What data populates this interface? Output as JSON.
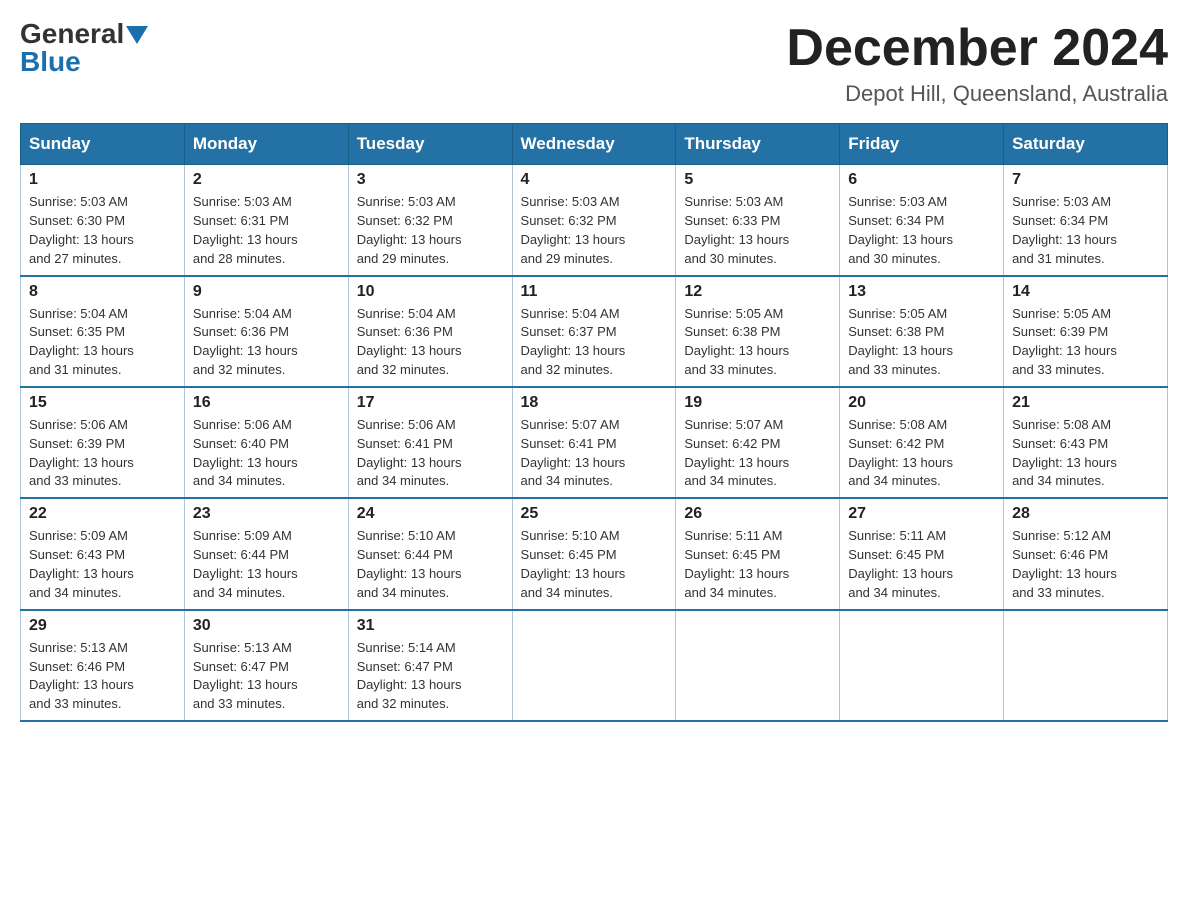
{
  "header": {
    "logo_general": "General",
    "logo_blue": "Blue",
    "title": "December 2024",
    "subtitle": "Depot Hill, Queensland, Australia"
  },
  "days_of_week": [
    "Sunday",
    "Monday",
    "Tuesday",
    "Wednesday",
    "Thursday",
    "Friday",
    "Saturday"
  ],
  "weeks": [
    [
      {
        "day": "1",
        "sunrise": "5:03 AM",
        "sunset": "6:30 PM",
        "daylight": "13 hours and 27 minutes."
      },
      {
        "day": "2",
        "sunrise": "5:03 AM",
        "sunset": "6:31 PM",
        "daylight": "13 hours and 28 minutes."
      },
      {
        "day": "3",
        "sunrise": "5:03 AM",
        "sunset": "6:32 PM",
        "daylight": "13 hours and 29 minutes."
      },
      {
        "day": "4",
        "sunrise": "5:03 AM",
        "sunset": "6:32 PM",
        "daylight": "13 hours and 29 minutes."
      },
      {
        "day": "5",
        "sunrise": "5:03 AM",
        "sunset": "6:33 PM",
        "daylight": "13 hours and 30 minutes."
      },
      {
        "day": "6",
        "sunrise": "5:03 AM",
        "sunset": "6:34 PM",
        "daylight": "13 hours and 30 minutes."
      },
      {
        "day": "7",
        "sunrise": "5:03 AM",
        "sunset": "6:34 PM",
        "daylight": "13 hours and 31 minutes."
      }
    ],
    [
      {
        "day": "8",
        "sunrise": "5:04 AM",
        "sunset": "6:35 PM",
        "daylight": "13 hours and 31 minutes."
      },
      {
        "day": "9",
        "sunrise": "5:04 AM",
        "sunset": "6:36 PM",
        "daylight": "13 hours and 32 minutes."
      },
      {
        "day": "10",
        "sunrise": "5:04 AM",
        "sunset": "6:36 PM",
        "daylight": "13 hours and 32 minutes."
      },
      {
        "day": "11",
        "sunrise": "5:04 AM",
        "sunset": "6:37 PM",
        "daylight": "13 hours and 32 minutes."
      },
      {
        "day": "12",
        "sunrise": "5:05 AM",
        "sunset": "6:38 PM",
        "daylight": "13 hours and 33 minutes."
      },
      {
        "day": "13",
        "sunrise": "5:05 AM",
        "sunset": "6:38 PM",
        "daylight": "13 hours and 33 minutes."
      },
      {
        "day": "14",
        "sunrise": "5:05 AM",
        "sunset": "6:39 PM",
        "daylight": "13 hours and 33 minutes."
      }
    ],
    [
      {
        "day": "15",
        "sunrise": "5:06 AM",
        "sunset": "6:39 PM",
        "daylight": "13 hours and 33 minutes."
      },
      {
        "day": "16",
        "sunrise": "5:06 AM",
        "sunset": "6:40 PM",
        "daylight": "13 hours and 34 minutes."
      },
      {
        "day": "17",
        "sunrise": "5:06 AM",
        "sunset": "6:41 PM",
        "daylight": "13 hours and 34 minutes."
      },
      {
        "day": "18",
        "sunrise": "5:07 AM",
        "sunset": "6:41 PM",
        "daylight": "13 hours and 34 minutes."
      },
      {
        "day": "19",
        "sunrise": "5:07 AM",
        "sunset": "6:42 PM",
        "daylight": "13 hours and 34 minutes."
      },
      {
        "day": "20",
        "sunrise": "5:08 AM",
        "sunset": "6:42 PM",
        "daylight": "13 hours and 34 minutes."
      },
      {
        "day": "21",
        "sunrise": "5:08 AM",
        "sunset": "6:43 PM",
        "daylight": "13 hours and 34 minutes."
      }
    ],
    [
      {
        "day": "22",
        "sunrise": "5:09 AM",
        "sunset": "6:43 PM",
        "daylight": "13 hours and 34 minutes."
      },
      {
        "day": "23",
        "sunrise": "5:09 AM",
        "sunset": "6:44 PM",
        "daylight": "13 hours and 34 minutes."
      },
      {
        "day": "24",
        "sunrise": "5:10 AM",
        "sunset": "6:44 PM",
        "daylight": "13 hours and 34 minutes."
      },
      {
        "day": "25",
        "sunrise": "5:10 AM",
        "sunset": "6:45 PM",
        "daylight": "13 hours and 34 minutes."
      },
      {
        "day": "26",
        "sunrise": "5:11 AM",
        "sunset": "6:45 PM",
        "daylight": "13 hours and 34 minutes."
      },
      {
        "day": "27",
        "sunrise": "5:11 AM",
        "sunset": "6:45 PM",
        "daylight": "13 hours and 34 minutes."
      },
      {
        "day": "28",
        "sunrise": "5:12 AM",
        "sunset": "6:46 PM",
        "daylight": "13 hours and 33 minutes."
      }
    ],
    [
      {
        "day": "29",
        "sunrise": "5:13 AM",
        "sunset": "6:46 PM",
        "daylight": "13 hours and 33 minutes."
      },
      {
        "day": "30",
        "sunrise": "5:13 AM",
        "sunset": "6:47 PM",
        "daylight": "13 hours and 33 minutes."
      },
      {
        "day": "31",
        "sunrise": "5:14 AM",
        "sunset": "6:47 PM",
        "daylight": "13 hours and 32 minutes."
      },
      null,
      null,
      null,
      null
    ]
  ],
  "labels": {
    "sunrise": "Sunrise:",
    "sunset": "Sunset:",
    "daylight": "Daylight:"
  }
}
